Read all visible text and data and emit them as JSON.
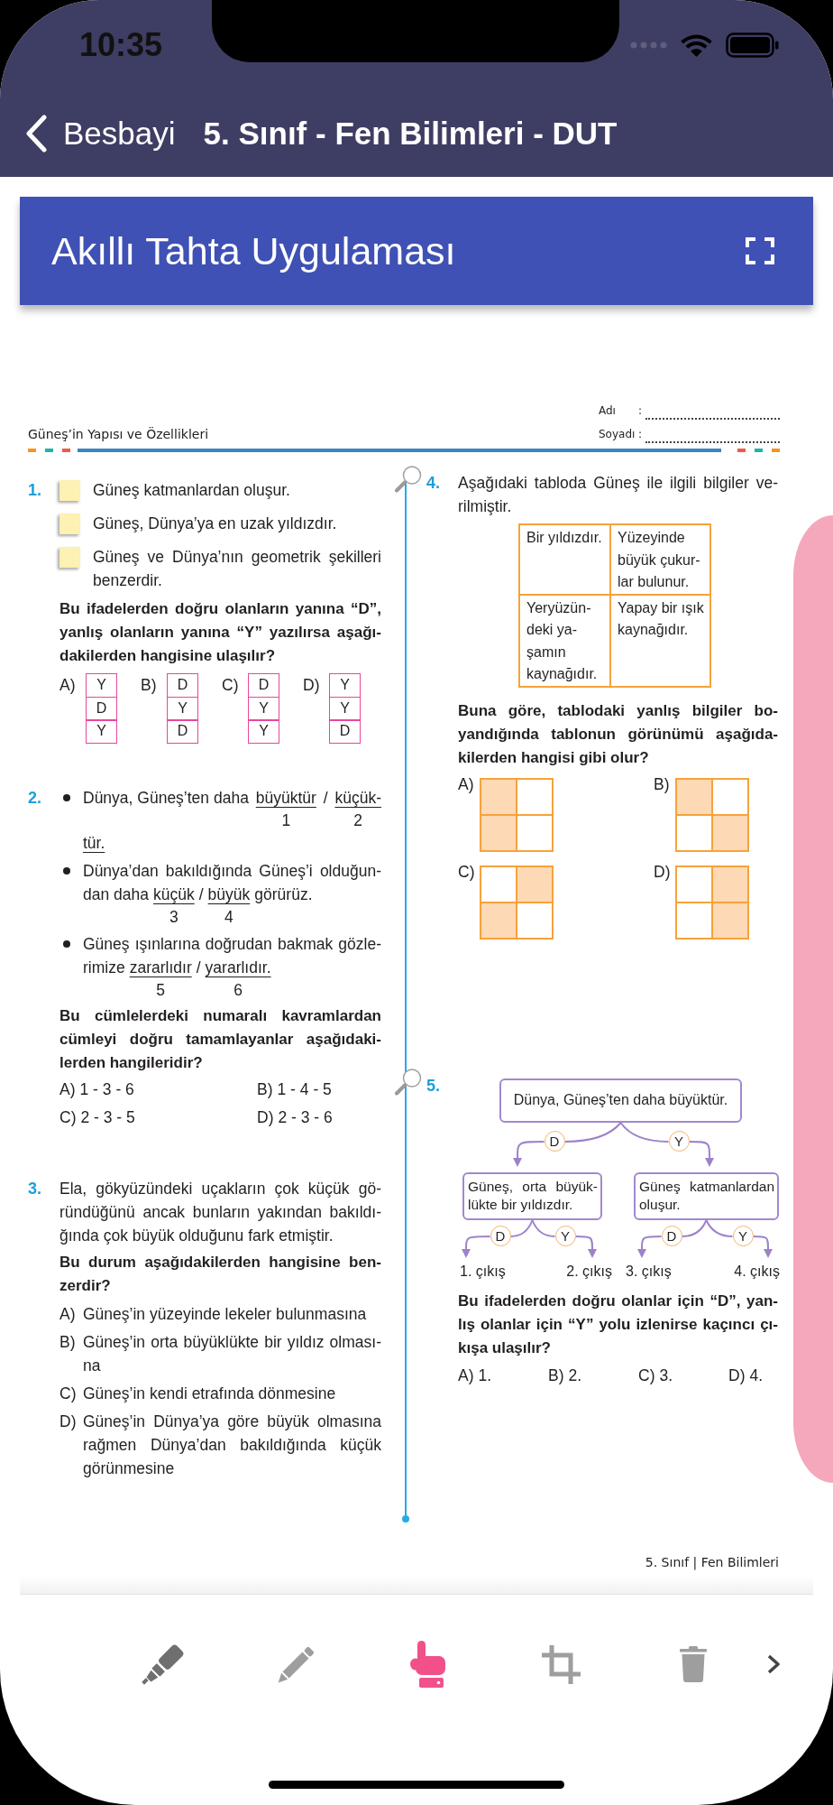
{
  "status_bar": {
    "time": "10:35"
  },
  "navigation": {
    "back_label": "Besbayi",
    "title": "5. Sınıf - Fen Bilimleri - DUT"
  },
  "app_header": {
    "title": "Akıllı Tahta Uygulaması"
  },
  "worksheet": {
    "title": "Güneş’in Yapısı ve Özellikleri",
    "fields": [
      {
        "label": "Adı",
        "separator": ":"
      },
      {
        "label": "Soyadı",
        "separator": ":"
      }
    ],
    "columns": [
      {
        "questions": [
          {
            "number": "1.",
            "parts": [
              {
                "kind": "checklist",
                "items": [
                  {
                    "lines": [
                      "Güneş katmanlardan oluşur."
                    ]
                  },
                  {
                    "lines": [
                      "Güneş, Dünya’ya en uzak yıldızdır."
                    ]
                  },
                  {
                    "lines": [
                      "Güneş ve Dünya’nın geometrik şekilleri",
                      "benzerdir."
                    ]
                  }
                ]
              },
              {
                "kind": "prompt",
                "lines": [
                  "Bu ifadelerden doğru olanların yanına “D”,",
                  "yanlış olanların yanına “Y” yazılırsa aşağı-",
                  "dakilerden hangisine ulaşılır?"
                ]
              },
              {
                "kind": "letter_tables",
                "options": [
                  {
                    "label": "A)",
                    "cells": [
                      "Y",
                      "D",
                      "Y"
                    ]
                  },
                  {
                    "label": "B)",
                    "cells": [
                      "D",
                      "Y",
                      "D"
                    ]
                  },
                  {
                    "label": "C)",
                    "cells": [
                      "D",
                      "Y",
                      "Y"
                    ]
                  },
                  {
                    "label": "D)",
                    "cells": [
                      "Y",
                      "Y",
                      "D"
                    ]
                  }
                ]
              }
            ]
          },
          {
            "number": "2.",
            "parts": [
              {
                "kind": "bullets",
                "items": [
                  {
                    "lines": [
                      [
                        {
                          "text": "Dünya, Güneş’ten daha",
                          "underlined": false
                        },
                        {
                          "text": "büyüktür",
                          "underlined": true,
                          "number": "1"
                        },
                        {
                          "text": "/",
                          "underlined": false
                        },
                        {
                          "text": "küçük-",
                          "underlined": true,
                          "number": "2"
                        }
                      ],
                      [
                        {
                          "text": "tür.",
                          "underlined": true
                        }
                      ]
                    ]
                  },
                  {
                    "lines": [
                      [
                        {
                          "text": "Dünya’dan bakıldığında Güneş’i olduğun-",
                          "underlined": false
                        }
                      ],
                      [
                        {
                          "text": "dan daha",
                          "underlined": false
                        },
                        {
                          "text": "küçük",
                          "underlined": true,
                          "number": "3"
                        },
                        {
                          "text": "/",
                          "underlined": false
                        },
                        {
                          "text": "büyük",
                          "underlined": true,
                          "number": "4"
                        },
                        {
                          "text": "görürüz.",
                          "underlined": false
                        }
                      ]
                    ]
                  },
                  {
                    "lines": [
                      [
                        {
                          "text": "Güneş ışınlarına doğrudan bakmak gözle-",
                          "underlined": false
                        }
                      ],
                      [
                        {
                          "text": "rimize",
                          "underlined": false
                        },
                        {
                          "text": "zararlıdır",
                          "underlined": true,
                          "number": "5"
                        },
                        {
                          "text": "/",
                          "underlined": false
                        },
                        {
                          "text": "yararlıdır.",
                          "underlined": true,
                          "number": "6"
                        }
                      ]
                    ]
                  }
                ]
              },
              {
                "kind": "prompt",
                "lines": [
                  "Bu cümlelerdeki numaralı kavramlardan",
                  "cümleyi doğru tamamlayanlar aşağıdaki-",
                  "lerden hangileridir?"
                ]
              },
              {
                "kind": "pair_options",
                "options": [
                  {
                    "label": "A)",
                    "text": "1 - 3 - 6"
                  },
                  {
                    "label": "B)",
                    "text": "1 - 4 - 5"
                  },
                  {
                    "label": "C)",
                    "text": "2 - 3 - 5"
                  },
                  {
                    "label": "D)",
                    "text": "2 - 3 - 6"
                  }
                ]
              }
            ]
          },
          {
            "number": "3.",
            "parts": [
              {
                "kind": "paragraph",
                "lines": [
                  "Ela, gökyüzündeki uçakların çok küçük gö-",
                  "ründüğünü ancak bunların yakından bakıldı-",
                  "ğında çok büyük olduğunu fark etmiştir."
                ]
              },
              {
                "kind": "prompt",
                "lines": [
                  "Bu durum aşağıdakilerden hangisine ben-",
                  "zerdir?"
                ]
              },
              {
                "kind": "list_options",
                "options": [
                  {
                    "label": "A)",
                    "lines": [
                      "Güneş’in yüzeyinde lekeler bulunmasına"
                    ]
                  },
                  {
                    "label": "B)",
                    "lines": [
                      "Güneş’in orta büyüklükte bir yıldız olması-",
                      "na"
                    ]
                  },
                  {
                    "label": "C)",
                    "lines": [
                      "Güneş’in kendi etrafında dönmesine"
                    ]
                  },
                  {
                    "label": "D)",
                    "lines": [
                      "Güneş’in Dünya’ya göre büyük olmasına",
                      "rağmen Dünya’dan bakıldığında küçük",
                      "görünmesine"
                    ]
                  }
                ]
              }
            ]
          }
        ]
      },
      {
        "questions": [
          {
            "number": "4.",
            "parts": [
              {
                "kind": "paragraph",
                "lines": [
                  "Aşağıdaki tabloda Güneş ile ilgili bilgiler ve-",
                  "rilmiştir."
                ]
              },
              {
                "kind": "table",
                "rows": [
                  {
                    "cells": [
                      {
                        "lines": [
                          "Bir yıldızdır."
                        ]
                      },
                      {
                        "lines": [
                          "Yüzeyinde",
                          "büyük çukur-",
                          "lar bulunur."
                        ]
                      }
                    ]
                  },
                  {
                    "cells": [
                      {
                        "lines": [
                          "Yeryüzün-",
                          "deki ya-",
                          "şamın",
                          "kaynağıdır."
                        ]
                      },
                      {
                        "lines": [
                          "Yapay bir ışık",
                          "kaynağıdır."
                        ]
                      }
                    ]
                  }
                ]
              },
              {
                "kind": "prompt",
                "lines": [
                  "Buna göre, tablodaki yanlış bilgiler bo-",
                  "yandığında tablonun görünümü aşağıda-",
                  "kilerden hangisi gibi olur?"
                ]
              },
              {
                "kind": "grid_options",
                "options": [
                  {
                    "label": "A)",
                    "cells": [
                      {
                        "shaded": true
                      },
                      {
                        "shaded": false
                      },
                      {
                        "shaded": true
                      },
                      {
                        "shaded": false
                      }
                    ]
                  },
                  {
                    "label": "B)",
                    "cells": [
                      {
                        "shaded": true
                      },
                      {
                        "shaded": false
                      },
                      {
                        "shaded": false
                      },
                      {
                        "shaded": true
                      }
                    ]
                  },
                  {
                    "label": "C)",
                    "cells": [
                      {
                        "shaded": false
                      },
                      {
                        "shaded": true
                      },
                      {
                        "shaded": true
                      },
                      {
                        "shaded": false
                      }
                    ]
                  },
                  {
                    "label": "D)",
                    "cells": [
                      {
                        "shaded": false
                      },
                      {
                        "shaded": true
                      },
                      {
                        "shaded": false
                      },
                      {
                        "shaded": true
                      }
                    ]
                  }
                ]
              }
            ]
          },
          {
            "number": "5.",
            "parts": [
              {
                "kind": "diagram",
                "root": "Dünya, Güneş’ten daha büyüktür.",
                "branches": [
                  {
                    "label": "D",
                    "node": {
                      "lines": [
                        "Güneş, orta büyük-",
                        "lükte bir yıldızdır."
                      ],
                      "branches": [
                        {
                          "label": "D",
                          "exit": "1. çıkış"
                        },
                        {
                          "label": "Y",
                          "exit": "2. çıkış"
                        }
                      ]
                    }
                  },
                  {
                    "label": "Y",
                    "node": {
                      "lines": [
                        "Güneş katmanlardan",
                        "oluşur."
                      ],
                      "branches": [
                        {
                          "label": "D",
                          "exit": "3. çıkış"
                        },
                        {
                          "label": "Y",
                          "exit": "4. çıkış"
                        }
                      ]
                    }
                  }
                ]
              },
              {
                "kind": "prompt",
                "lines": [
                  "Bu ifadelerden doğru olanlar için “D”, yan-",
                  "lış olanlar için “Y” yolu izlenirse kaçıncı çı-",
                  "kışa ulaşılır?"
                ]
              },
              {
                "kind": "row_options",
                "options": [
                  {
                    "label": "A)",
                    "text": "1."
                  },
                  {
                    "label": "B)",
                    "text": "2."
                  },
                  {
                    "label": "C)",
                    "text": "3."
                  },
                  {
                    "label": "D)",
                    "text": "4."
                  }
                ]
              }
            ]
          }
        ]
      }
    ],
    "footer": "5. Sınıf | Fen Bilimleri"
  },
  "toolbar": {
    "tools": [
      {
        "kind": "highlighter",
        "selected": false
      },
      {
        "kind": "pencil",
        "selected": false
      },
      {
        "kind": "pointer",
        "selected": true
      },
      {
        "kind": "crop",
        "selected": false
      },
      {
        "kind": "delete",
        "selected": false
      }
    ]
  }
}
